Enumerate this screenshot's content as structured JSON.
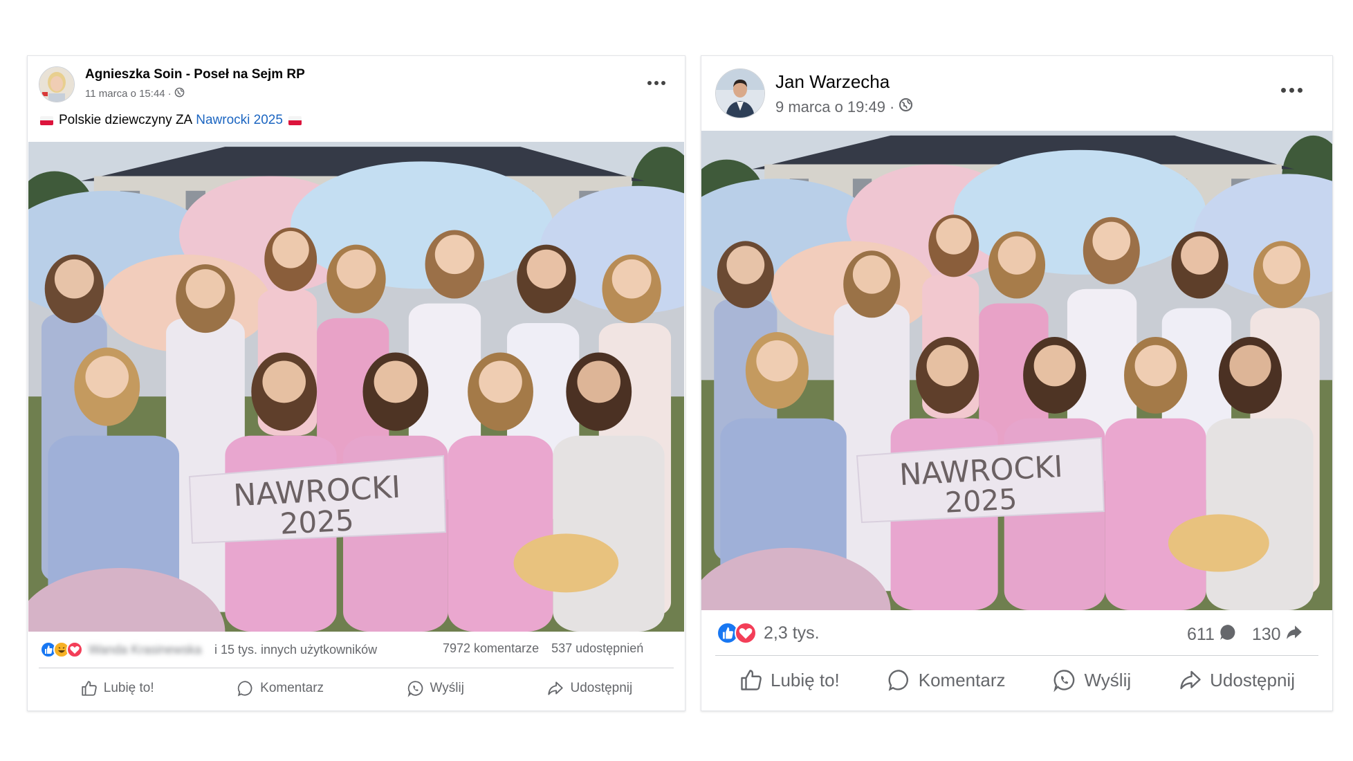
{
  "posts": [
    {
      "author": "Agnieszka Soin - Poseł na Sejm RP",
      "date": "11 marca o 15:44",
      "separator": "·",
      "text_before": "Polskie dziewczyny ZA",
      "text_link": "Nawrocki 2025",
      "photo_banner_line1": "NAWROCKI",
      "photo_banner_line2": "2025",
      "reaction_names_blurred": "Wanda Krasinewska",
      "reaction_others": "i 15 tys. innych użytkowników",
      "comments": "7972 komentarze",
      "shares": "537 udostępnień",
      "actions": {
        "like": "Lubię to!",
        "comment": "Komentarz",
        "send": "Wyślij",
        "share": "Udostępnij"
      }
    },
    {
      "author": "Jan Warzecha",
      "date": "9 marca o 19:49",
      "separator": "·",
      "photo_banner_line1": "NAWROCKI",
      "photo_banner_line2": "2025",
      "reaction_count": "2,3 tys.",
      "comments": "611",
      "shares": "130",
      "actions": {
        "like": "Lubię to!",
        "comment": "Komentarz",
        "send": "Wyślij",
        "share": "Udostępnij"
      }
    }
  ],
  "colors": {
    "link": "#1b65c1",
    "like_blue": "#1877f2",
    "love_red": "#f33e58",
    "haha_yellow": "#f7b125",
    "secondary_text": "#65676b"
  },
  "icons": [
    "globe-icon",
    "more-options-icon",
    "poland-flag-icon",
    "like-reaction-icon",
    "haha-reaction-icon",
    "love-reaction-icon",
    "thumbs-up-icon",
    "comment-icon",
    "whatsapp-icon",
    "share-icon"
  ]
}
